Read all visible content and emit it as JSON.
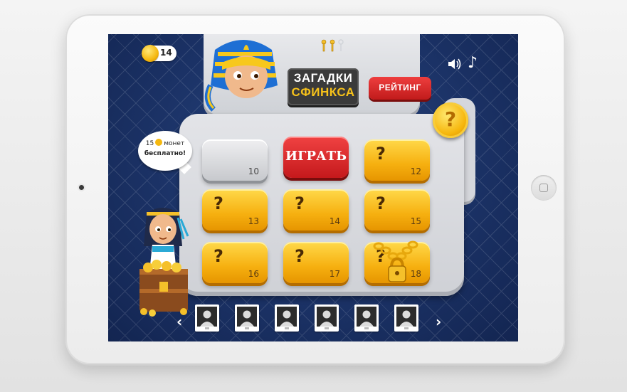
{
  "game": {
    "coins": "14",
    "title_line1": "ЗАГАДКИ",
    "title_line2": "СФИНКСА",
    "rating_button": "РЕЙТИНГ",
    "hint_symbol": "?",
    "promo": {
      "amount": "15",
      "word": "монет",
      "line2": "бесплатно!"
    },
    "levels": [
      {
        "number": "10",
        "state": "completed",
        "label": ""
      },
      {
        "number": "",
        "state": "play",
        "label": "ИГРАТЬ"
      },
      {
        "number": "12",
        "state": "open",
        "label": "?"
      },
      {
        "number": "13",
        "state": "open",
        "label": "?"
      },
      {
        "number": "14",
        "state": "open",
        "label": "?"
      },
      {
        "number": "15",
        "state": "open",
        "label": "?"
      },
      {
        "number": "16",
        "state": "open",
        "label": "?"
      },
      {
        "number": "17",
        "state": "open",
        "label": "?"
      },
      {
        "number": "18",
        "state": "locked",
        "label": "?"
      }
    ],
    "nav": {
      "prev": "‹",
      "next": "›"
    },
    "friends_slots": 6
  },
  "colors": {
    "screen_bg": "#1b3266",
    "gold": "#f6b010",
    "red": "#c5191c",
    "stone": "#d5d7dc"
  },
  "icons": [
    "coin-icon",
    "keys-icon",
    "sound-icon",
    "music-note-icon",
    "hint-coin-icon",
    "lock-chain-icon",
    "avatar-placeholder-icon"
  ]
}
